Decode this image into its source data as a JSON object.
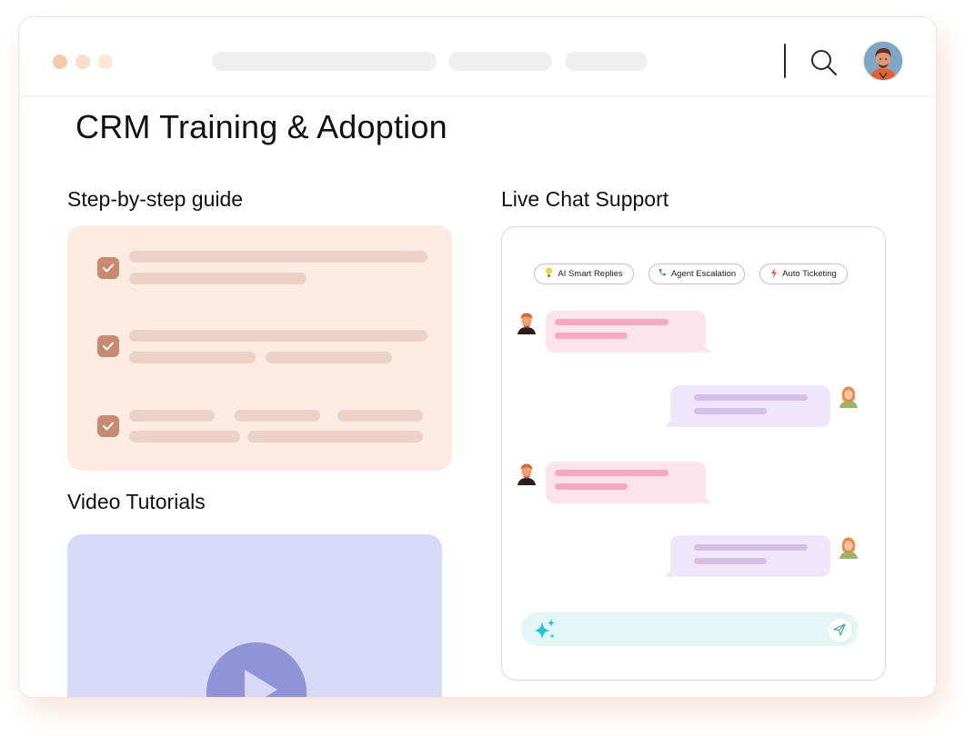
{
  "page": {
    "title": "CRM Training & Adoption"
  },
  "sections": {
    "guide_title": "Step-by-step guide",
    "video_title": "Video Tutorials",
    "chat_title": "Live Chat Support"
  },
  "chat": {
    "chips": [
      {
        "label": "AI Smart Replies",
        "icon": "lightbulb-icon"
      },
      {
        "label": "Agent Escalation",
        "icon": "phone-icon"
      },
      {
        "label": "Auto Ticketing",
        "icon": "lightning-icon"
      }
    ]
  },
  "colors": {
    "guide_bg": "#fdebe2",
    "check": "#c98a72",
    "video_bg": "#d8d9f7",
    "play": "#9093d6",
    "incoming_bubble": "#fde4ec",
    "outgoing_bubble": "#f0e6fb",
    "composer_bg": "#e4f7f6"
  }
}
